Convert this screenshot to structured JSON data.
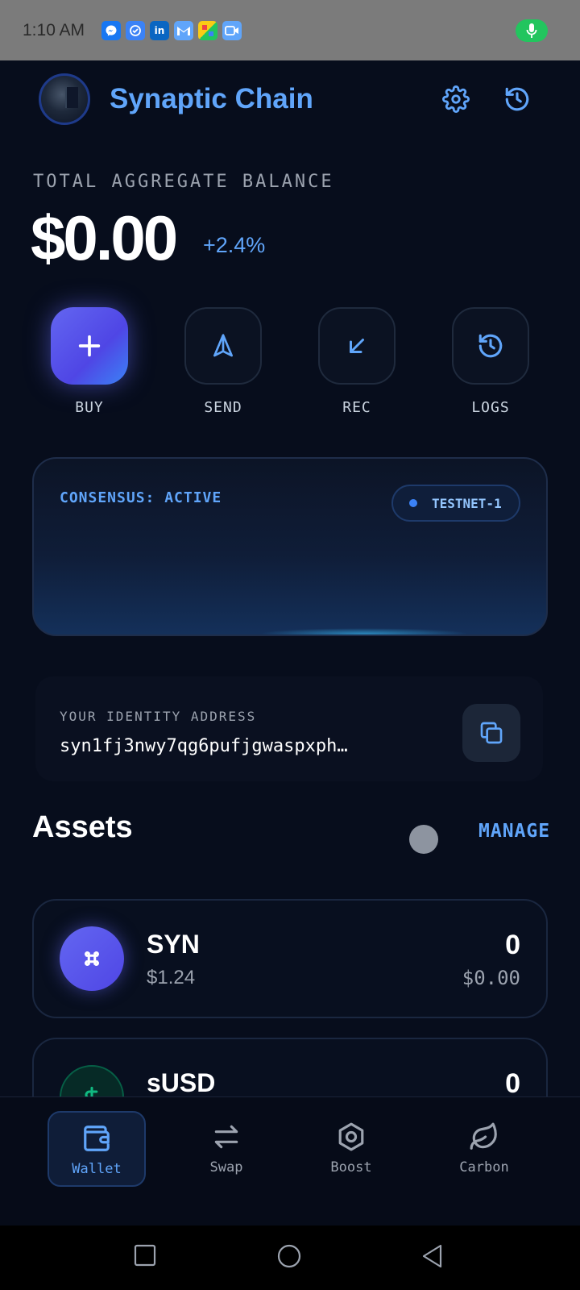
{
  "status_bar": {
    "time": "1:10 AM",
    "notification_icons": [
      "messenger-icon",
      "check-icon",
      "linkedin-icon",
      "gmail-icon",
      "gallery-icon",
      "meet-icon"
    ],
    "mic_color": "#22c55e"
  },
  "header": {
    "title": "Synaptic Chain",
    "settings_icon": "gear-icon",
    "history_icon": "history-icon"
  },
  "balance": {
    "label": "TOTAL AGGREGATE BALANCE",
    "amount": "$0.00",
    "change": "+2.4%"
  },
  "actions": [
    {
      "label": "BUY",
      "icon": "plus-icon"
    },
    {
      "label": "SEND",
      "icon": "send-icon"
    },
    {
      "label": "REC",
      "icon": "receive-arrow-icon"
    },
    {
      "label": "LOGS",
      "icon": "history-icon"
    }
  ],
  "consensus": {
    "status": "CONSENSUS: ACTIVE",
    "network": "TESTNET-1"
  },
  "identity": {
    "label": "YOUR IDENTITY ADDRESS",
    "address": "syn1fj3nwy7qg6pufjgwaspxph…"
  },
  "assets": {
    "title": "Assets",
    "manage_label": "MANAGE",
    "items": [
      {
        "symbol": "SYN",
        "price": "$1.24",
        "quantity": "0",
        "value": "$0.00",
        "icon": "command-icon"
      },
      {
        "symbol": "sUSD",
        "price": "",
        "quantity": "0",
        "value": "",
        "icon": "dollar-icon"
      }
    ]
  },
  "bottom_nav": {
    "items": [
      {
        "label": "Wallet",
        "icon": "wallet-icon",
        "active": true
      },
      {
        "label": "Swap",
        "icon": "swap-icon",
        "active": false
      },
      {
        "label": "Boost",
        "icon": "hexagon-icon",
        "active": false
      },
      {
        "label": "Carbon",
        "icon": "leaf-icon",
        "active": false
      }
    ]
  },
  "colors": {
    "accent": "#60a5fa",
    "primary_button": "#6366f1",
    "background": "#070d1c"
  }
}
